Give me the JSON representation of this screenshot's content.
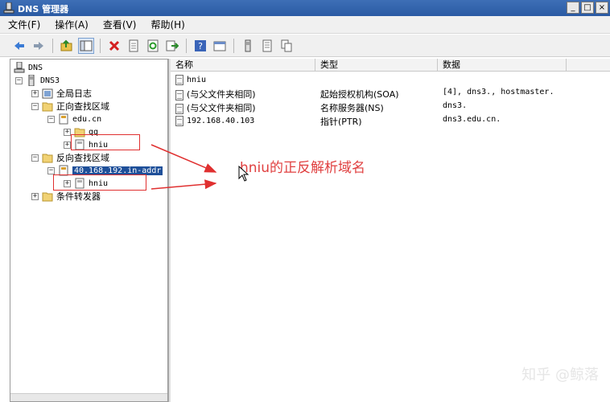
{
  "window": {
    "title": "DNS 管理器",
    "buttons": [
      "_",
      "□",
      "×"
    ]
  },
  "menu": [
    "文件(F)",
    "操作(A)",
    "查看(V)",
    "帮助(H)"
  ],
  "toolbar": {
    "icons": [
      "back-arrow-icon",
      "forward-arrow-icon",
      "up-folder-icon",
      "show-tree-icon",
      "delete-icon",
      "properties-icon",
      "refresh-icon",
      "export-icon",
      "help-icon",
      "console-icon",
      "server-icon",
      "list-icon",
      "copy-icon"
    ]
  },
  "tree": {
    "root": "DNS",
    "server": "DNS3",
    "global_logs": "全局日志",
    "forward_zones": "正向查找区域",
    "edu_cn": "edu.cn",
    "qq": "qq",
    "hniu_forward": "hniu",
    "reverse_zones": "反向查找区域",
    "reverse_zone": "40.168.192.in-addr",
    "hniu_reverse": "hniu",
    "conditional_forwarders": "条件转发器"
  },
  "list": {
    "columns": [
      "名称",
      "类型",
      "数据"
    ],
    "rows": [
      {
        "name": "hniu",
        "type": "",
        "data": ""
      },
      {
        "name": "(与父文件夹相同)",
        "type": "起始授权机构(SOA)",
        "data": "[4], dns3., hostmaster."
      },
      {
        "name": "(与父文件夹相同)",
        "type": "名称服务器(NS)",
        "data": "dns3."
      },
      {
        "name": "192.168.40.103",
        "type": "指针(PTR)",
        "data": "dns3.edu.cn."
      }
    ]
  },
  "annotation": {
    "text": "hniu的正反解析域名",
    "color": "#e04040"
  },
  "watermark": "知乎 @鲸落",
  "colors": {
    "titlebar": "#2a5aa3",
    "selection": "#1e4f99",
    "annotation_red": "#e03030"
  }
}
